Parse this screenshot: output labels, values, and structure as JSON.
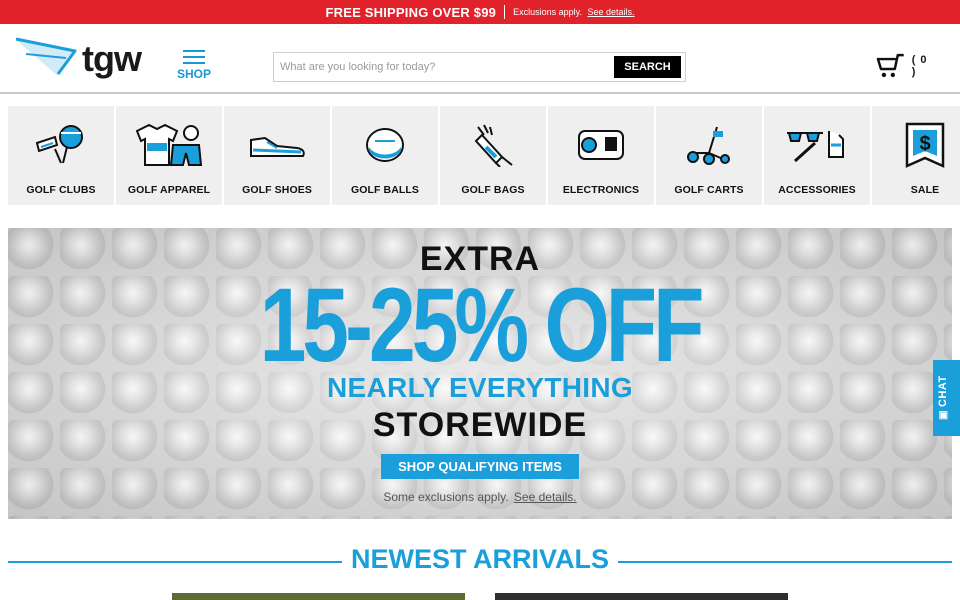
{
  "promo": {
    "main": "FREE SHIPPING OVER $99",
    "note": "Exclusions apply.",
    "link": "See details."
  },
  "header": {
    "logo_text": "tgw",
    "shop_label": "SHOP",
    "search_placeholder": "What are you looking for today?",
    "search_button": "SEARCH",
    "cart_count": "( 0 )"
  },
  "categories": [
    {
      "label": "GOLF CLUBS",
      "icon": "golf-clubs-icon"
    },
    {
      "label": "GOLF APPAREL",
      "icon": "golf-apparel-icon"
    },
    {
      "label": "GOLF SHOES",
      "icon": "golf-shoe-icon"
    },
    {
      "label": "GOLF BALLS",
      "icon": "golf-ball-icon"
    },
    {
      "label": "GOLF BAGS",
      "icon": "golf-bag-icon"
    },
    {
      "label": "ELECTRONICS",
      "icon": "rangefinder-icon"
    },
    {
      "label": "GOLF CARTS",
      "icon": "golf-cart-icon"
    },
    {
      "label": "ACCESSORIES",
      "icon": "accessories-icon"
    },
    {
      "label": "SALE",
      "icon": "sale-tag-icon"
    }
  ],
  "hero": {
    "line1": "EXTRA",
    "line2": "15-25% OFF",
    "line3": "NEARLY EVERYTHING",
    "line4": "STOREWIDE",
    "cta": "SHOP QUALIFYING ITEMS",
    "exclusions": "Some exclusions apply.",
    "exclusions_link": "See details."
  },
  "chat": {
    "label": "CHAT"
  },
  "arrivals": {
    "title": "NEWEST ARRIVALS"
  },
  "colors": {
    "brand_blue": "#1a9fdb",
    "promo_red": "#e1222a",
    "text_dark": "#111111"
  }
}
